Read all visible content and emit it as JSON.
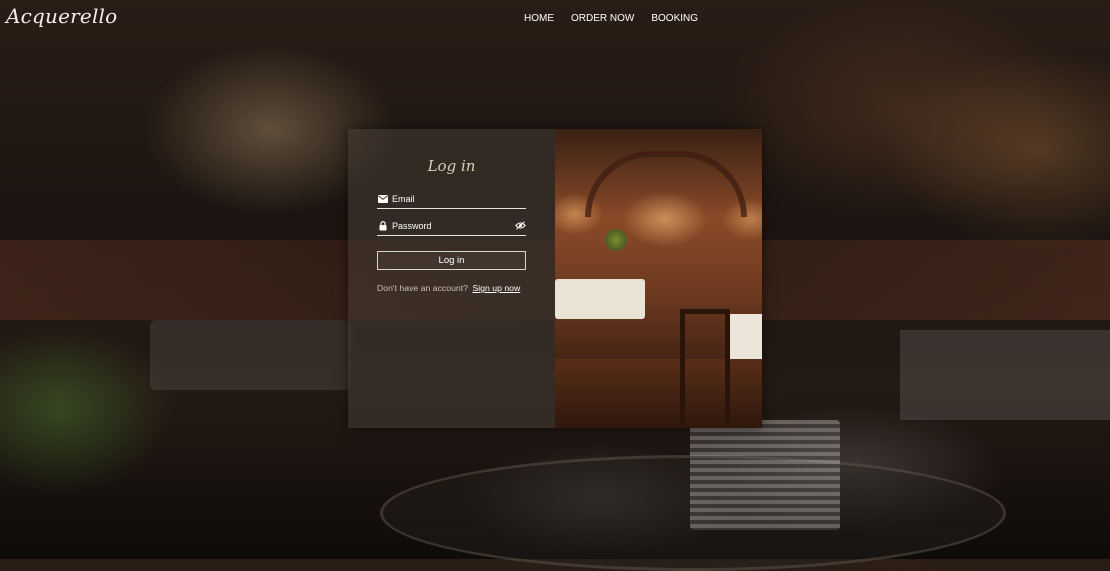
{
  "brand": {
    "logo_text": "Acquerello"
  },
  "nav": {
    "items": [
      {
        "label": "HOME"
      },
      {
        "label": "ORDER NOW"
      },
      {
        "label": "BOOKING"
      }
    ]
  },
  "login": {
    "title": "Log in",
    "email_placeholder": "Email",
    "password_placeholder": "Password",
    "submit_label": "Log in",
    "signup_prompt": "Don't have an account?",
    "signup_link": "Sign up now"
  },
  "icons": {
    "email": "envelope-icon",
    "password": "lock-icon",
    "toggle_visibility": "eye-slash-icon"
  }
}
